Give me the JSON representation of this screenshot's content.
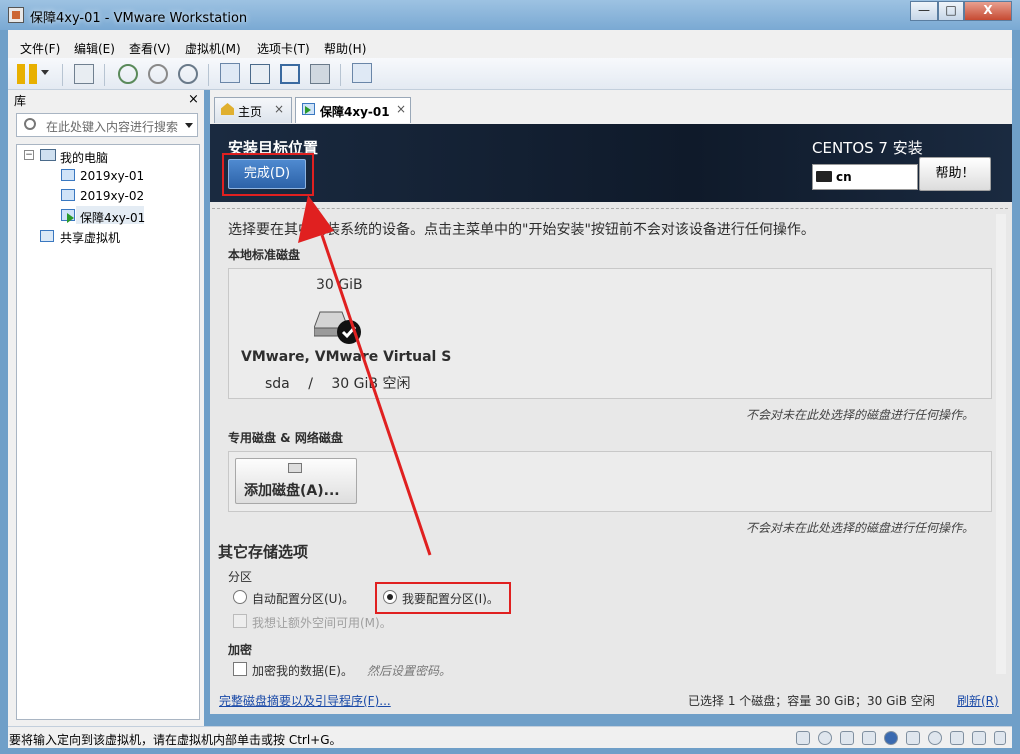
{
  "window": {
    "title": "保障4xy-01 - VMware Workstation",
    "minimize": "—",
    "maximize": "□",
    "close": "X"
  },
  "menu": [
    "文件(F)",
    "编辑(E)",
    "查看(V)",
    "虚拟机(M)",
    "选项卡(T)",
    "帮助(H)"
  ],
  "library": {
    "title": "库",
    "close": "×",
    "search_placeholder": "在此处键入内容进行搜索",
    "tree": {
      "root": "我的电脑",
      "vms": [
        "2019xy-01",
        "2019xy-02",
        "保障4xy-01"
      ],
      "shared": "共享虚拟机"
    }
  },
  "tabs": [
    {
      "label": "主页",
      "close": "×"
    },
    {
      "label": "保障4xy-01",
      "close": "×"
    }
  ],
  "installer": {
    "title": "安装目标位置",
    "done_button": "完成(D)",
    "product": "CENTOS 7 安装",
    "keyboard": "cn",
    "help_button": "帮助！",
    "intro": "选择要在其中安装系统的设备。点击主菜单中的\"开始安装\"按钮前不会对该设备进行任何操作。",
    "local_disks_label": "本地标准磁盘",
    "disk": {
      "size": "30 GiB",
      "name": "VMware, VMware Virtual S",
      "device": "sda",
      "separator": "/",
      "free": "30 GiB 空闲"
    },
    "note_unselected": "不会对未在此处选择的磁盘进行任何操作。",
    "specialized_label": "专用磁盘 & 网络磁盘",
    "add_disk_button": "添加磁盘(A)...",
    "other_options_title": "其它存储选项",
    "partition_label": "分区",
    "auto_partition": "自动配置分区(U)。",
    "manual_partition": "我要配置分区(I)。",
    "extra_space": "我想让额外空间可用(M)。",
    "encryption_label": "加密",
    "encrypt_data": "加密我的数据(E)。",
    "encrypt_hint": "然后设置密码。",
    "full_summary_link": "完整磁盘摘要以及引导程序(F)...",
    "selection_summary": "已选择 1 个磁盘；容量 30 GiB；30 GiB 空闲",
    "refresh_link": "刷新(R)"
  },
  "status_bar": {
    "text": "要将输入定向到该虚拟机，请在虚拟机内部单击或按 Ctrl+G。"
  },
  "colors": {
    "accent_blue": "#2c62a8",
    "highlight_red": "#e02020",
    "header_dark": "#0f1a2a"
  }
}
